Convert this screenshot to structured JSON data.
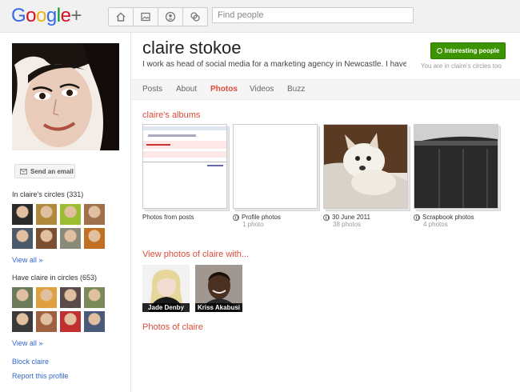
{
  "header": {
    "logo_letters": [
      "G",
      "o",
      "o",
      "g",
      "l",
      "e",
      "+"
    ],
    "logo_colors": [
      "#3369e8",
      "#d50f25",
      "#eeb211",
      "#3369e8",
      "#009925",
      "#d50f25",
      "#666666"
    ],
    "nav_icons": [
      "home-icon",
      "photos-icon",
      "profile-icon",
      "circles-icon"
    ],
    "search_placeholder": "Find people"
  },
  "profile": {
    "name": "claire stokoe",
    "tagline": "I work as head of social media for a marketing agency in Newcastle. I have w",
    "interest_button": "Interesting people",
    "circle_status": "You are in claire's circles too"
  },
  "tabs": [
    {
      "label": "Posts",
      "active": false
    },
    {
      "label": "About",
      "active": false
    },
    {
      "label": "Photos",
      "active": true
    },
    {
      "label": "Videos",
      "active": false
    },
    {
      "label": "Buzz",
      "active": false
    }
  ],
  "sidebar": {
    "send_email": "Send an email",
    "in_circles_title": "In claire's circles (331)",
    "in_circles_link": "View all »",
    "have_circles_title": "Have claire in circles (653)",
    "have_circles_link": "View all »",
    "block": "Block claire",
    "report": "Report this profile",
    "in_circles_thumbs": [
      "#2a2a2a",
      "#b08a3a",
      "#9bbf30",
      "#a0704a",
      "#4a5a6a",
      "#7a5030",
      "#8a8a7a",
      "#c07020"
    ],
    "have_circles_thumbs": [
      "#6a7a5a",
      "#e0a040",
      "#5a4a4a",
      "#7a8a5a",
      "#3a3a3a",
      "#a06040",
      "#c03030",
      "#4a5a7a"
    ]
  },
  "albums_section": {
    "title": "claire's albums",
    "albums": [
      {
        "label": "Photos from posts",
        "count": "",
        "public": false
      },
      {
        "label": "Profile photos",
        "count": "1 photo",
        "public": true
      },
      {
        "label": "30 June 2011",
        "count": "38 photos",
        "public": true
      },
      {
        "label": "Scrapbook photos",
        "count": "4 photos",
        "public": true
      }
    ]
  },
  "with_section": {
    "title": "View photos of claire with...",
    "people": [
      "Jade Denby",
      "Kriss Akabusi"
    ]
  },
  "photos_of_title": "Photos of claire"
}
